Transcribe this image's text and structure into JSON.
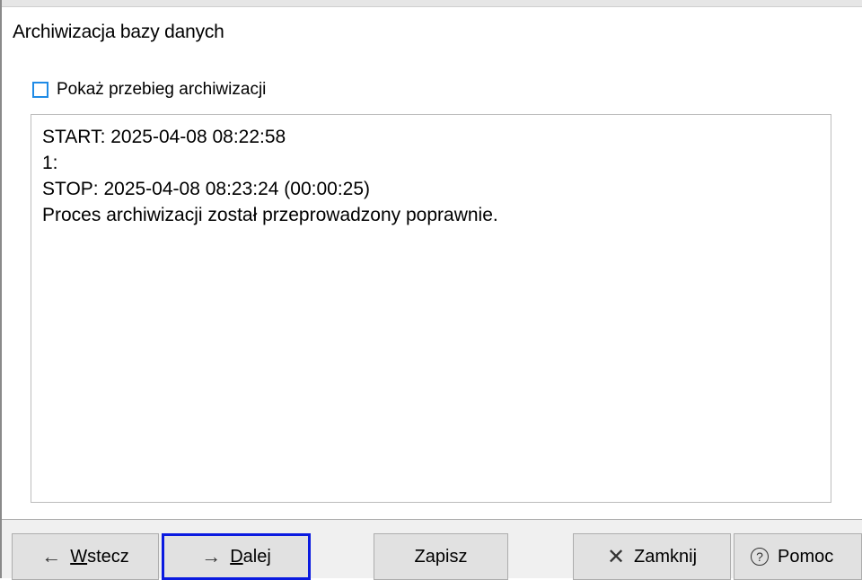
{
  "dialog": {
    "title": "Archiwizacja bazy danych",
    "show_progress_label": "Pokaż przebieg archiwizacji",
    "show_progress_checked": false
  },
  "log": {
    "lines": [
      "START: 2025-04-08 08:22:58",
      "1:",
      "STOP: 2025-04-08 08:23:24 (00:00:25)",
      "Proces archiwizacji został przeprowadzony poprawnie."
    ]
  },
  "buttons": {
    "back": {
      "icon": "arrow-left-icon",
      "mnemonic": "W",
      "rest": "stecz"
    },
    "next": {
      "icon": "arrow-right-icon",
      "mnemonic": "D",
      "rest": "alej"
    },
    "save": {
      "label": "Zapisz"
    },
    "close": {
      "icon": "close-icon",
      "label": "Zamknij"
    },
    "help": {
      "icon": "help-icon",
      "label": "Pomoc"
    }
  },
  "colors": {
    "default_button_border": "#0a1ae0",
    "checkbox_border": "#1f8be6",
    "footer_bg": "#f0f0f0",
    "button_bg": "#e1e1e1"
  }
}
